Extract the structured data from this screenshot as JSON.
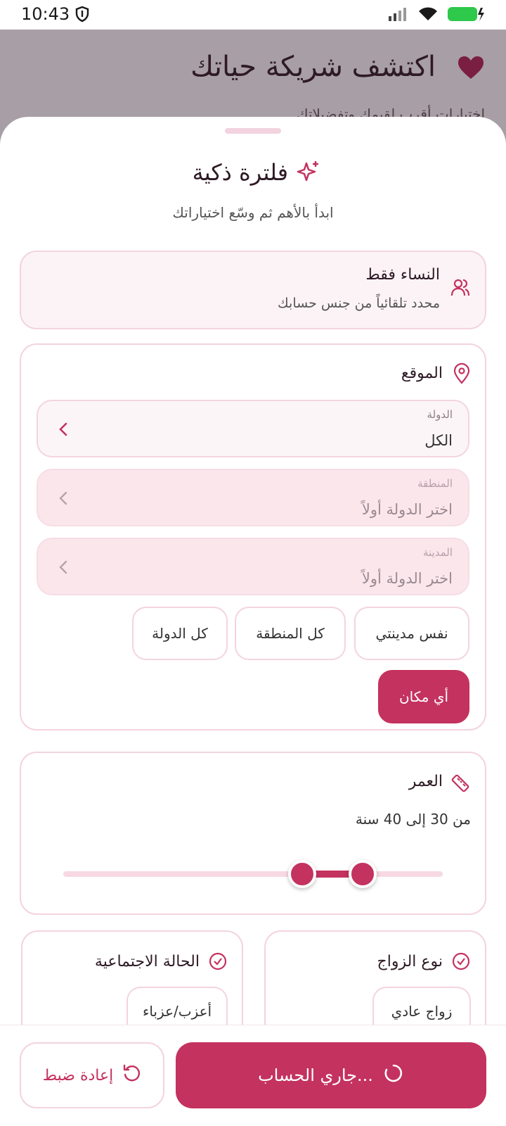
{
  "status_bar": {
    "time": "10:43"
  },
  "background": {
    "title": "اكتشف شريكة حياتك",
    "subtitle": "اختيارات أقرب لقيمك وتفضيلاتك"
  },
  "sheet": {
    "title": "فلترة ذكية",
    "subtitle": "ابدأ بالأهم ثم وسّع اختياراتك"
  },
  "gender": {
    "title": "النساء فقط",
    "subtitle": "محدد تلقائياً من جنس حسابك"
  },
  "location": {
    "title": "الموقع",
    "country": {
      "label": "الدولة",
      "value": "الكل"
    },
    "region": {
      "label": "المنطقة",
      "value": "اختر الدولة أولاً"
    },
    "city": {
      "label": "المدينة",
      "value": "اختر الدولة أولاً"
    },
    "chips": [
      "نفس مدينتي",
      "كل المنطقة",
      "كل الدولة",
      "أي مكان"
    ],
    "active_chip": "أي مكان"
  },
  "age": {
    "title": "العمر",
    "range_text": "من 30 إلى 40 سنة",
    "min": 30,
    "max": 40
  },
  "marriage_type": {
    "title": "نوع الزواج",
    "option": "زواج عادي"
  },
  "marital_status": {
    "title": "الحالة الاجتماعية",
    "option": "أعزب/عزباء"
  },
  "actions": {
    "calculate_label": "جاري الحساب...",
    "reset_label": "إعادة ضبط"
  },
  "colors": {
    "accent": "#c4325f",
    "border": "#f3d4df",
    "backdrop": "#a89ea5"
  }
}
